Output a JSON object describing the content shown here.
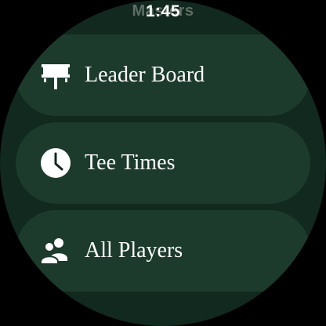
{
  "status_bar": {
    "app_title": "Masters",
    "time": "1:45"
  },
  "menu": {
    "items": [
      {
        "label": "Leader Board",
        "icon": "leaderboard-icon"
      },
      {
        "label": "Tee Times",
        "icon": "clock-icon"
      },
      {
        "label": "All Players",
        "icon": "players-icon"
      }
    ]
  },
  "colors": {
    "background": "#11291f",
    "item_background": "#1c3b2d",
    "text": "#ffffff"
  }
}
